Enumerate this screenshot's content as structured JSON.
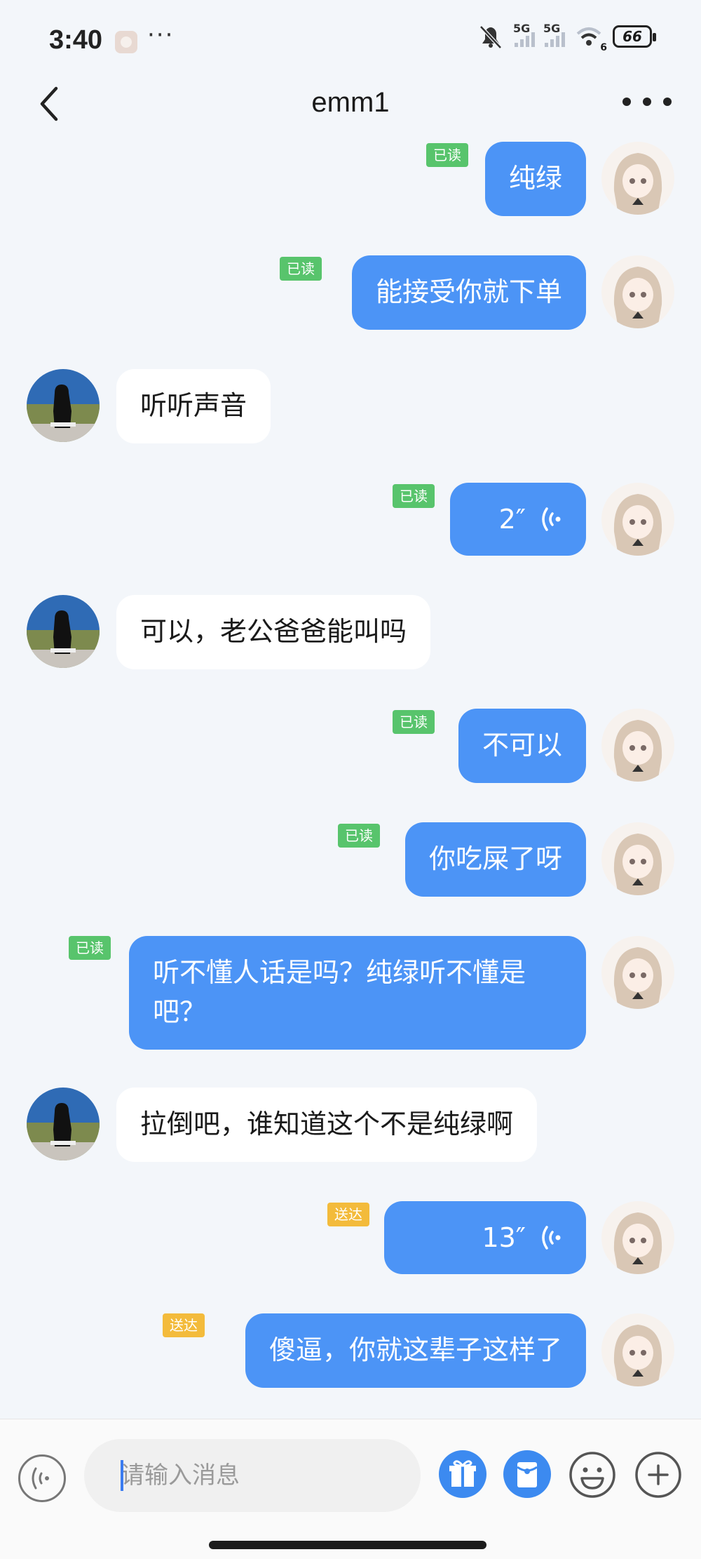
{
  "status": {
    "time": "3:40",
    "more": "···",
    "net1": "5G",
    "net2": "5G",
    "wifi_sub": "6",
    "battery": "66"
  },
  "header": {
    "title": "emm1"
  },
  "messages": [
    {
      "text": "纯绿",
      "status": "已读"
    },
    {
      "text": "能接受你就下单",
      "status": "已读"
    },
    {
      "text": "听听声音"
    },
    {
      "text": "2″",
      "status": "已读"
    },
    {
      "text": "可以，老公爸爸能叫吗"
    },
    {
      "text": "不可以",
      "status": "已读"
    },
    {
      "text": "你吃屎了呀",
      "status": "已读"
    },
    {
      "text": "听不懂人话是吗？纯绿听不懂是吧？",
      "status": "已读"
    },
    {
      "text": "拉倒吧，谁知道这个不是纯绿啊"
    },
    {
      "text": "13″",
      "status": "送达"
    },
    {
      "text": "傻逼，你就这辈子这样了",
      "status": "送达"
    }
  ],
  "input": {
    "placeholder": "请输入消息"
  },
  "colors": {
    "accent": "#4c94f6",
    "read_badge": "#58c46c",
    "sent_badge": "#f3bb3b",
    "background": "#f3f6fa"
  }
}
